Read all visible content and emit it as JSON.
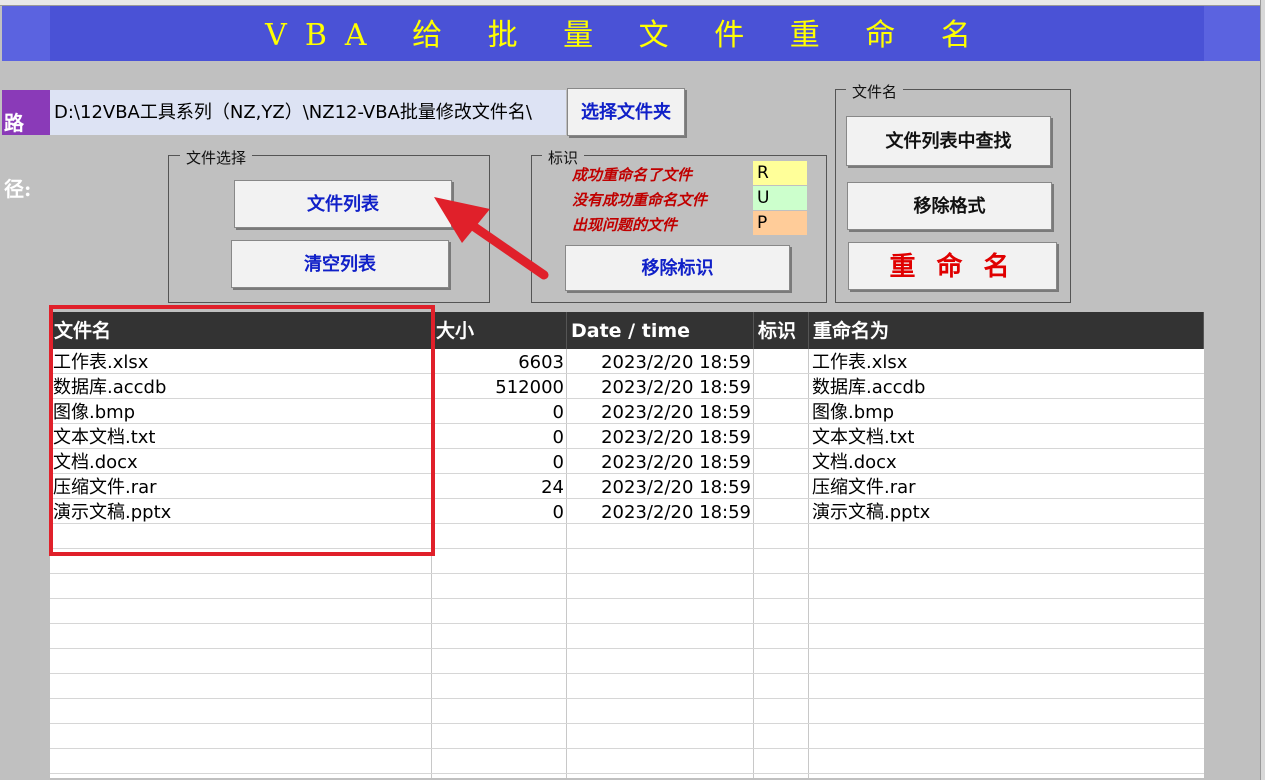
{
  "banner": {
    "title": "VBA 给 批 量 文 件 重 命 名"
  },
  "path": {
    "label": "路径:",
    "value": "D:\\12VBA工具系列（NZ,YZ）\\NZ12-VBA批量修改文件名\\"
  },
  "buttons": {
    "select_folder": "选择文件夹",
    "file_list": "文件列表",
    "clear_list": "清空列表",
    "remove_mark": "移除标识",
    "find_in_list": "文件列表中查找",
    "remove_format": "移除格式",
    "rename": "重 命 名"
  },
  "groups": {
    "file_select": "文件选择",
    "mark": "标识",
    "file_name": "文件名"
  },
  "legend": [
    {
      "label": "成功重命名了文件",
      "code": "R",
      "color": "#ffff99"
    },
    {
      "label": "没有成功重命名文件",
      "code": "U",
      "color": "#ccffcc"
    },
    {
      "label": "出现问题的文件",
      "code": "P",
      "color": "#ffcc99"
    }
  ],
  "table": {
    "headers": [
      "文件名",
      "大小",
      "Date / time",
      "标识",
      "重命名为"
    ],
    "rows": [
      [
        "工作表.xlsx",
        "6603",
        "2023/2/20 18:59",
        "",
        "工作表.xlsx"
      ],
      [
        "数据库.accdb",
        "512000",
        "2023/2/20 18:59",
        "",
        "数据库.accdb"
      ],
      [
        "图像.bmp",
        "0",
        "2023/2/20 18:59",
        "",
        "图像.bmp"
      ],
      [
        "文本文档.txt",
        "0",
        "2023/2/20 18:59",
        "",
        "文本文档.txt"
      ],
      [
        "文档.docx",
        "0",
        "2023/2/20 18:59",
        "",
        "文档.docx"
      ],
      [
        "压缩文件.rar",
        "24",
        "2023/2/20 18:59",
        "",
        "压缩文件.rar"
      ],
      [
        "演示文稿.pptx",
        "0",
        "2023/2/20 18:59",
        "",
        "演示文稿.pptx"
      ]
    ]
  },
  "colors": {
    "banner": "#4a52d6",
    "title": "#ffff00",
    "highlight": "#e0202a",
    "button_text": "#1020c8",
    "rename_text": "#e00000"
  }
}
